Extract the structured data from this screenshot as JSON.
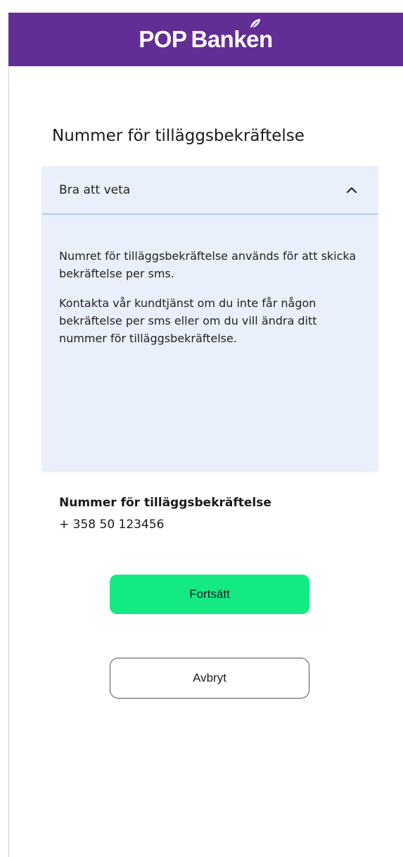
{
  "header": {
    "brand": {
      "word1": "POP",
      "word2": "Banken"
    }
  },
  "page": {
    "title": "Nummer för tilläggsbekräftelse"
  },
  "accordion": {
    "title": "Bra att veta",
    "expanded": true,
    "paragraphs": [
      "Numret för tilläggsbekräftelse används för att skicka bekräftelse per sms.",
      "Kontakta vår kundtjänst om du inte får någon bekräftelse per sms eller om du vill ändra ditt nummer för tilläggsbekräftelse."
    ]
  },
  "info": {
    "label": "Nummer för tilläggsbekräftelse",
    "value": "+ 358 50 123456"
  },
  "buttons": {
    "continue_label": "Fortsätt",
    "cancel_label": "Avbryt"
  },
  "colors": {
    "brand_purple": "#632d96",
    "accordion_bg": "#eaf0fb",
    "primary_button": "#14ea84"
  },
  "icons": {
    "accordion_toggle": "chevron-up-icon",
    "logo_mark": "leaf-icon"
  }
}
